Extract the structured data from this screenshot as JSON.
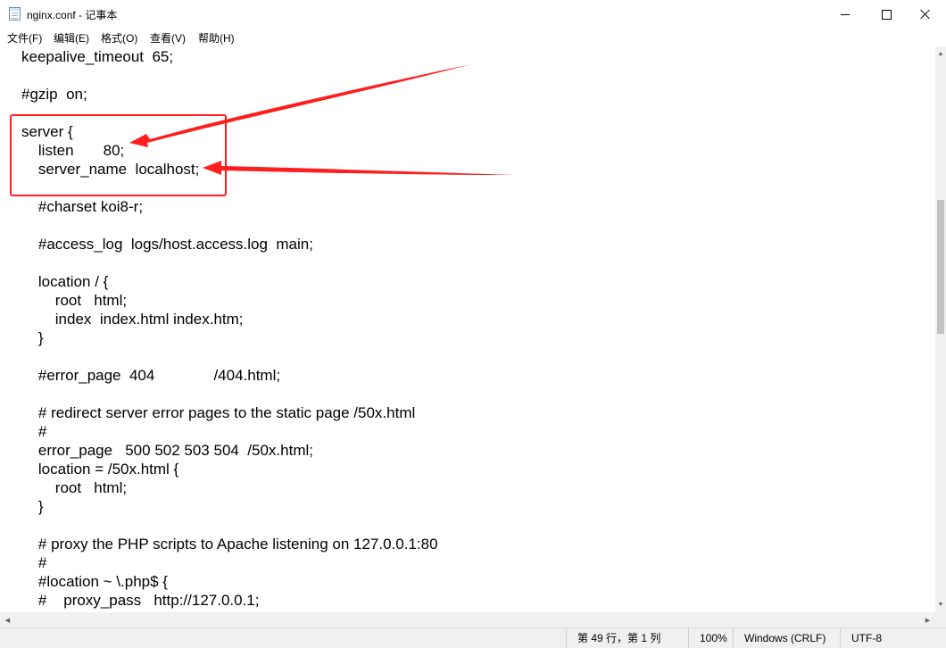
{
  "window": {
    "title": "nginx.conf - 记事本",
    "icon": "notepad-icon"
  },
  "menu": [
    {
      "label": "文件(F)"
    },
    {
      "label": "编辑(E)"
    },
    {
      "label": "格式(O)"
    },
    {
      "label": "查看(V)"
    },
    {
      "label": "帮助(H)"
    }
  ],
  "editor": {
    "lines": [
      "keepalive_timeout  65;",
      "",
      "#gzip  on;",
      "",
      "server {",
      "    listen       80;",
      "    server_name  localhost;",
      "",
      "    #charset koi8-r;",
      "",
      "    #access_log  logs/host.access.log  main;",
      "",
      "    location / {",
      "        root   html;",
      "        index  index.html index.htm;",
      "    }",
      "",
      "    #error_page  404              /404.html;",
      "",
      "    # redirect server error pages to the static page /50x.html",
      "    #",
      "    error_page   500 502 503 504  /50x.html;",
      "    location = /50x.html {",
      "        root   html;",
      "    }",
      "",
      "    # proxy the PHP scripts to Apache listening on 127.0.0.1:80",
      "    #",
      "    #location ~ \\.php$ {",
      "    #    proxy_pass   http://127.0.0.1;",
      "    #}"
    ]
  },
  "annotation": {
    "color": "#ff1e1e"
  },
  "status": {
    "position": "第 49 行，第 1 列",
    "zoom": "100%",
    "line_ending": "Windows (CRLF)",
    "encoding": "UTF-8"
  }
}
